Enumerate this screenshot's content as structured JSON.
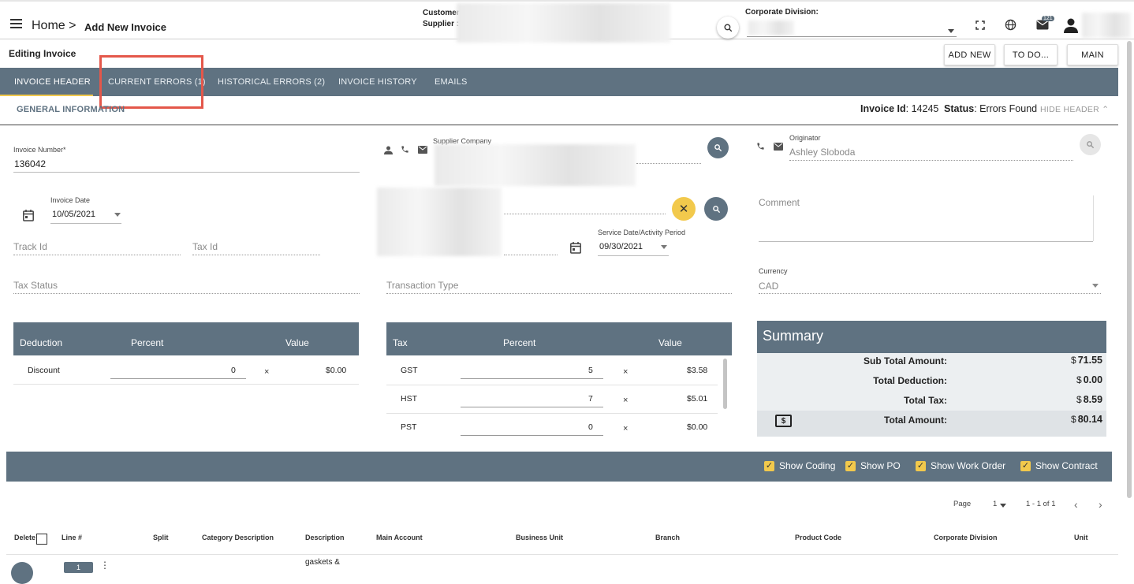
{
  "header": {
    "home": "Home >",
    "page_title": "Add New Invoice",
    "customer_label": "Customer :",
    "supplier_label": "Supplier :",
    "corporate_division_label": "Corporate Division:",
    "notification_count": "121"
  },
  "toolbar": {
    "editing_title": "Editing Invoice",
    "add_new": "ADD NEW",
    "todo": "TO DO...",
    "main": "MAIN"
  },
  "tabs": [
    {
      "label": "INVOICE HEADER"
    },
    {
      "label": "CURRENT ERRORS (1)"
    },
    {
      "label": "HISTORICAL ERRORS (2)"
    },
    {
      "label": "INVOICE HISTORY"
    },
    {
      "label": "EMAILS"
    }
  ],
  "info": {
    "general_information": "GENERAL INFORMATION",
    "invoice_id_label": "Invoice Id",
    "invoice_id": ": 14245",
    "status_label": "Status",
    "status": ": Errors Found",
    "hide_header": "HIDE HEADER"
  },
  "form": {
    "invoice_number_label": "Invoice Number*",
    "invoice_number": "136042",
    "supplier_company_label": "Supplier Company",
    "originator_label": "Originator",
    "originator": "Ashley Sloboda",
    "invoice_date_label": "Invoice Date",
    "invoice_date": "10/05/2021",
    "comment_placeholder": "Comment",
    "track_id_placeholder": "Track Id",
    "tax_id_placeholder": "Tax Id",
    "service_date_label": "Service Date/Activity Period",
    "service_date": "09/30/2021",
    "tax_status_placeholder": "Tax Status",
    "transaction_type_placeholder": "Transaction Type",
    "currency_label": "Currency",
    "currency": "CAD"
  },
  "deduction_table": {
    "headers": [
      "Deduction",
      "Percent",
      "Value"
    ],
    "rows": [
      {
        "name": "Discount",
        "percent": "0",
        "value": "$0.00"
      }
    ]
  },
  "tax_table": {
    "headers": [
      "Tax",
      "Percent",
      "Value"
    ],
    "rows": [
      {
        "name": "GST",
        "percent": "5",
        "value": "$3.58"
      },
      {
        "name": "HST",
        "percent": "7",
        "value": "$5.01"
      },
      {
        "name": "PST",
        "percent": "0",
        "value": "$0.00"
      }
    ]
  },
  "summary": {
    "title": "Summary",
    "rows": [
      {
        "label": "Sub Total Amount:",
        "value": "71.55"
      },
      {
        "label": "Total Deduction:",
        "value": "0.00"
      },
      {
        "label": "Total Tax:",
        "value": "8.59"
      },
      {
        "label": "Total Amount:",
        "value": "80.14"
      }
    ],
    "currency_symbol": "$"
  },
  "options": [
    {
      "label": "Show Coding"
    },
    {
      "label": "Show PO"
    },
    {
      "label": "Show Work Order"
    },
    {
      "label": "Show Contract"
    }
  ],
  "pager": {
    "page_label": "Page",
    "page": "1",
    "range": "1 - 1 of 1"
  },
  "grid": {
    "headers": [
      "Delete",
      "Line #",
      "Split",
      "Category Description",
      "Description",
      "Main Account",
      "Business Unit",
      "Branch",
      "Product Code",
      "Corporate Division",
      "Unit"
    ],
    "first_row_description": "gaskets &",
    "first_row_line": "1"
  },
  "colors": {
    "bar": "#5f7281",
    "accent": "#f2c94c",
    "highlight": "#e4574a"
  }
}
